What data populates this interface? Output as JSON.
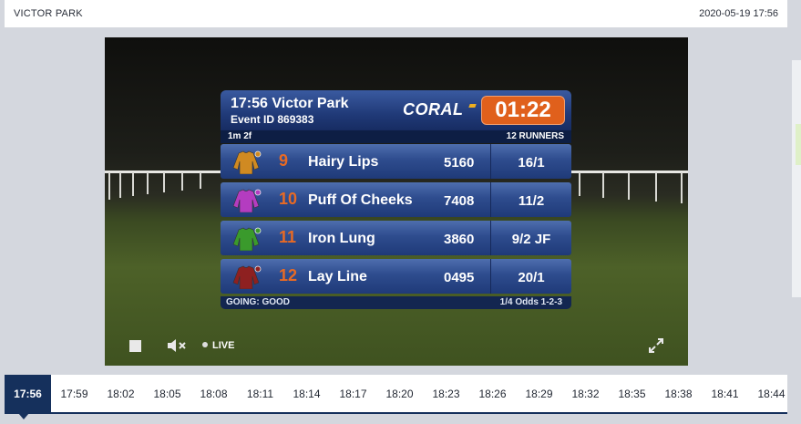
{
  "header": {
    "venue": "VICTOR PARK",
    "datetime": "2020-05-19  17:56"
  },
  "race_card": {
    "time_venue": "17:56 Victor Park",
    "event_id": "Event ID 869383",
    "brand": "CORAL",
    "countdown": "01:22",
    "distance": "1m 2f",
    "runners_label": "12 RUNNERS",
    "going": "GOING: GOOD",
    "place_terms": "1/4 Odds 1-2-3",
    "colors": {
      "brand_orange": "#e0601c",
      "panel_blue": "#203a78"
    },
    "runners": [
      {
        "number": "9",
        "name": "Hairy Lips",
        "form": "5160",
        "odds": "16/1",
        "silk_color": "#d08a22"
      },
      {
        "number": "10",
        "name": "Puff Of Cheeks",
        "form": "7408",
        "odds": "11/2",
        "silk_color": "#b43cc0"
      },
      {
        "number": "11",
        "name": "Iron Lung",
        "form": "3860",
        "odds": "9/2 JF",
        "silk_color": "#3a9a2c"
      },
      {
        "number": "12",
        "name": "Lay Line",
        "form": "0495",
        "odds": "20/1",
        "silk_color": "#8e2020"
      }
    ]
  },
  "player": {
    "live_label": "LIVE",
    "icons": [
      "stop-icon",
      "mute-icon",
      "fullscreen-icon"
    ]
  },
  "schedule": {
    "active_index": 0,
    "times": [
      "17:56",
      "17:59",
      "18:02",
      "18:05",
      "18:08",
      "18:11",
      "18:14",
      "18:17",
      "18:20",
      "18:23",
      "18:26",
      "18:29",
      "18:32",
      "18:35",
      "18:38",
      "18:41",
      "18:44"
    ]
  }
}
